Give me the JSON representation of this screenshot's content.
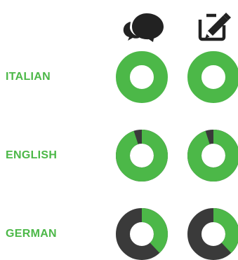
{
  "colors": {
    "primary": "#4cb848",
    "secondary": "#3a3a3a",
    "label": "#4cb848",
    "icon": "#222222"
  },
  "columns": [
    {
      "icon": "speech-bubbles-icon"
    },
    {
      "icon": "edit-pencil-icon"
    }
  ],
  "chart_data": {
    "type": "pie",
    "rows": [
      {
        "label": "ITALIAN",
        "values": [
          100,
          100
        ]
      },
      {
        "label": "ENGLISH",
        "values": [
          95,
          95
        ]
      },
      {
        "label": "GERMAN",
        "values": [
          38,
          38
        ]
      }
    ]
  }
}
